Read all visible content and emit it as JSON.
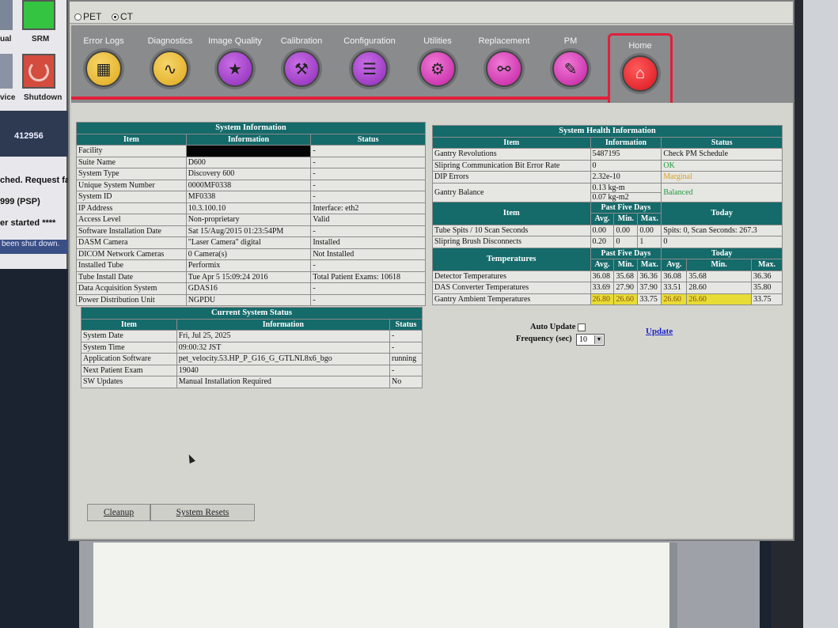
{
  "left_panel": {
    "srm_label": "SRM",
    "ual_label": "ual",
    "vice_label": "vice",
    "shutdown_label": "Shutdown",
    "number": "412956",
    "msg1": "ched. Request fa",
    "msg2": "999 (PSP)",
    "msg3": "er started ****",
    "msg4": "been shut down."
  },
  "modality": {
    "pet": "PET",
    "ct": "CT",
    "selected": "CT"
  },
  "nav": [
    {
      "label": "Error Logs",
      "icon": "grid-icon",
      "glyph": "▦",
      "color": "yellow"
    },
    {
      "label": "Diagnostics",
      "icon": "stethoscope-icon",
      "glyph": "∿",
      "color": "yellow"
    },
    {
      "label": "Image Quality",
      "icon": "monitor-star-icon",
      "glyph": "★",
      "color": "purple"
    },
    {
      "label": "Calibration",
      "icon": "hammer-icon",
      "glyph": "⚒",
      "color": "purple"
    },
    {
      "label": "Configuration",
      "icon": "checklist-icon",
      "glyph": "☰",
      "color": "purple"
    },
    {
      "label": "Utilities",
      "icon": "toolbox-icon",
      "glyph": "⚙",
      "color": "magenta"
    },
    {
      "label": "Replacement",
      "icon": "parts-icon",
      "glyph": "⚯",
      "color": "magenta"
    },
    {
      "label": "PM",
      "icon": "clipboard-tools-icon",
      "glyph": "✎",
      "color": "magenta"
    },
    {
      "label": "Home",
      "icon": "home-icon",
      "glyph": "⌂",
      "color": "red"
    }
  ],
  "system_info": {
    "title": "System Information",
    "headers": [
      "Item",
      "Information",
      "Status"
    ],
    "rows": [
      [
        "Facility",
        "",
        "-"
      ],
      [
        "Suite Name",
        "D600",
        "-"
      ],
      [
        "System Type",
        "Discovery 600",
        "-"
      ],
      [
        "Unique System Number",
        "0000MF0338",
        "-"
      ],
      [
        "System ID",
        "MF0338",
        "-"
      ],
      [
        "IP Address",
        "10.3.100.10",
        "Interface: eth2"
      ],
      [
        "Access Level",
        "Non-proprietary",
        "Valid"
      ],
      [
        "Software Installation Date",
        "Sat 15/Aug/2015 01:23:54PM",
        "-"
      ],
      [
        "DASM Camera",
        "\"Laser Camera\" digital",
        "Installed"
      ],
      [
        "DICOM Network Cameras",
        "0 Camera(s)",
        "Not Installed"
      ],
      [
        "Installed Tube",
        "Performix",
        "-"
      ],
      [
        "Tube Install Date",
        "Tue Apr 5 15:09:24 2016",
        "Total Patient Exams: 10618"
      ],
      [
        "Data Acquisition System",
        "GDAS16",
        "-"
      ],
      [
        "Power Distribution Unit",
        "NGPDU",
        "-"
      ]
    ]
  },
  "current_status": {
    "title": "Current System Status",
    "headers": [
      "Item",
      "Information",
      "Status"
    ],
    "rows": [
      [
        "System Date",
        "Fri, Jul 25, 2025",
        "-"
      ],
      [
        "System Time",
        "09:00:32 JST",
        "-"
      ],
      [
        "Application Software",
        "pet_velocity.53.HP_P_G16_G_GTLNI.8x6_bgo",
        "running"
      ],
      [
        "Next Patient Exam",
        "19040",
        "-"
      ],
      [
        "SW Updates",
        "Manual Installation Required",
        "No"
      ]
    ]
  },
  "health": {
    "title": "System Health Information",
    "headers": [
      "Item",
      "Information",
      "Status"
    ],
    "gantry_revolutions": [
      "Gantry Revolutions",
      "5487195",
      "Check PM Schedule"
    ],
    "slipring_ber": [
      "Slipring Communication Bit Error Rate",
      "0",
      "OK"
    ],
    "dip_errors": [
      "DIP Errors",
      "2.32e-10",
      "Marginal"
    ],
    "gantry_balance": [
      "Gantry Balance",
      "0.13 kg-m",
      "0.07 kg-m2",
      "Balanced"
    ],
    "past5_header": "Past Five Days",
    "today_header": "Today",
    "item_header": "Item",
    "sub_headers": [
      "Avg.",
      "Min.",
      "Max."
    ],
    "tube_spits": {
      "label": "Tube Spits / 10 Scan Seconds",
      "values": [
        "0.00",
        "0.00",
        "0.00"
      ],
      "today": "Spits: 0, Scan Seconds: 267.3"
    },
    "slipring_brush": {
      "label": "Slipring Brush Disconnects",
      "values": [
        "0.20",
        "0",
        "1"
      ],
      "today": "0"
    },
    "temperatures_header": "Temperatures",
    "temps": [
      {
        "label": "Detector Temperatures",
        "p5": [
          "36.08",
          "35.68",
          "36.36"
        ],
        "today": [
          "36.08",
          "35.68",
          "36.36"
        ]
      },
      {
        "label": "DAS Converter Temperatures",
        "p5": [
          "33.69",
          "27.90",
          "37.90"
        ],
        "today": [
          "33.51",
          "28.60",
          "35.80"
        ]
      },
      {
        "label": "Gantry Ambient Temperatures",
        "p5": [
          "26.80",
          "26.60",
          "33.75"
        ],
        "today": [
          "26.60",
          "26.60",
          "33.75"
        ]
      }
    ]
  },
  "auto_update": {
    "label": "Auto Update",
    "freq_label": "Frequency (sec)",
    "freq_value": "10",
    "update_link": "Update"
  },
  "buttons": {
    "cleanup": "Cleanup",
    "system_resets": "System Resets"
  }
}
